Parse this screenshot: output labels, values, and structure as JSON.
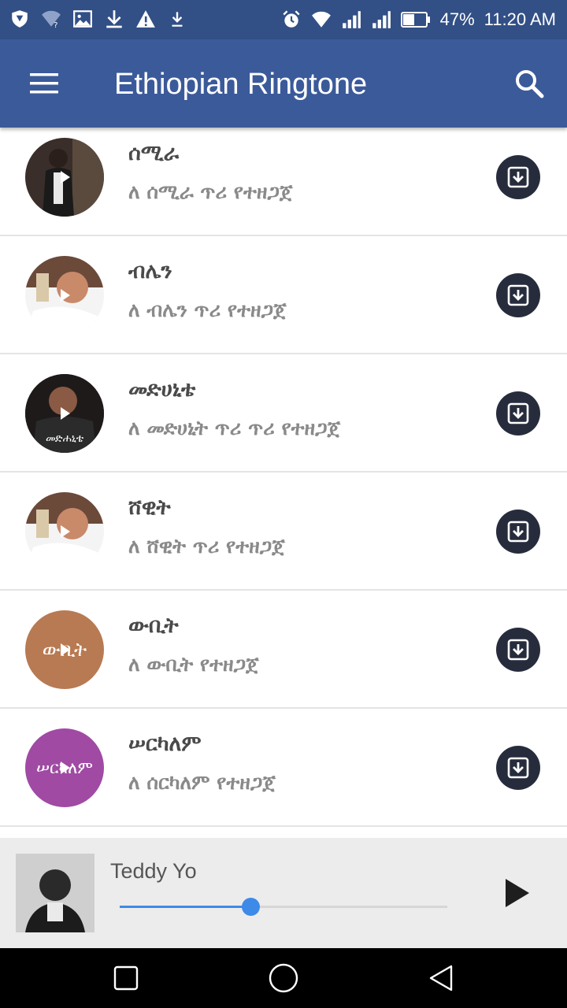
{
  "status_bar": {
    "battery": "47%",
    "time": "11:20 AM"
  },
  "app_bar": {
    "title": "Ethiopian Ringtone"
  },
  "list": {
    "items": [
      {
        "title": "ሰሚራ",
        "subtitle": "ለ ሰሚራ ጥሪ የተዘጋጀ",
        "thumb_text": "",
        "thumb_color": "#3a2e2a"
      },
      {
        "title": "ብሌን",
        "subtitle": "ለ ብሌን  ጥሪ የተዘጋጀ",
        "thumb_text": "",
        "thumb_color": "#6b4a3a"
      },
      {
        "title": "መድሀኒቴ",
        "subtitle": "ለ መድሀኒት ጥሪ ጥሪ የተዘጋጀ",
        "thumb_text": "መድሐኒቴ",
        "thumb_color": "#1f1a1a"
      },
      {
        "title": "ሸዊት",
        "subtitle": "ለ ሸዊት ጥሪ የተዘጋጀ",
        "thumb_text": "",
        "thumb_color": "#6b4a3a"
      },
      {
        "title": "ውቢት",
        "subtitle": "ለ ውቢት የተዘጋጀ",
        "thumb_text": "ውቢት",
        "thumb_color": "#b87a52"
      },
      {
        "title": "ሠርካለም",
        "subtitle": "ለ ሰርካለም የተዘጋጀ",
        "thumb_text": "ሠርካለም",
        "thumb_color": "#a04aa4"
      }
    ]
  },
  "player": {
    "title": "Teddy Yo",
    "progress": 0.4
  },
  "colors": {
    "status_bar": "#324f86",
    "app_bar": "#3b5a9a",
    "accent": "#3d8ae8",
    "download_button": "#272c3d"
  },
  "icons": {
    "menu": "menu-icon",
    "search": "search-icon",
    "download": "download-icon",
    "play": "play-icon"
  }
}
